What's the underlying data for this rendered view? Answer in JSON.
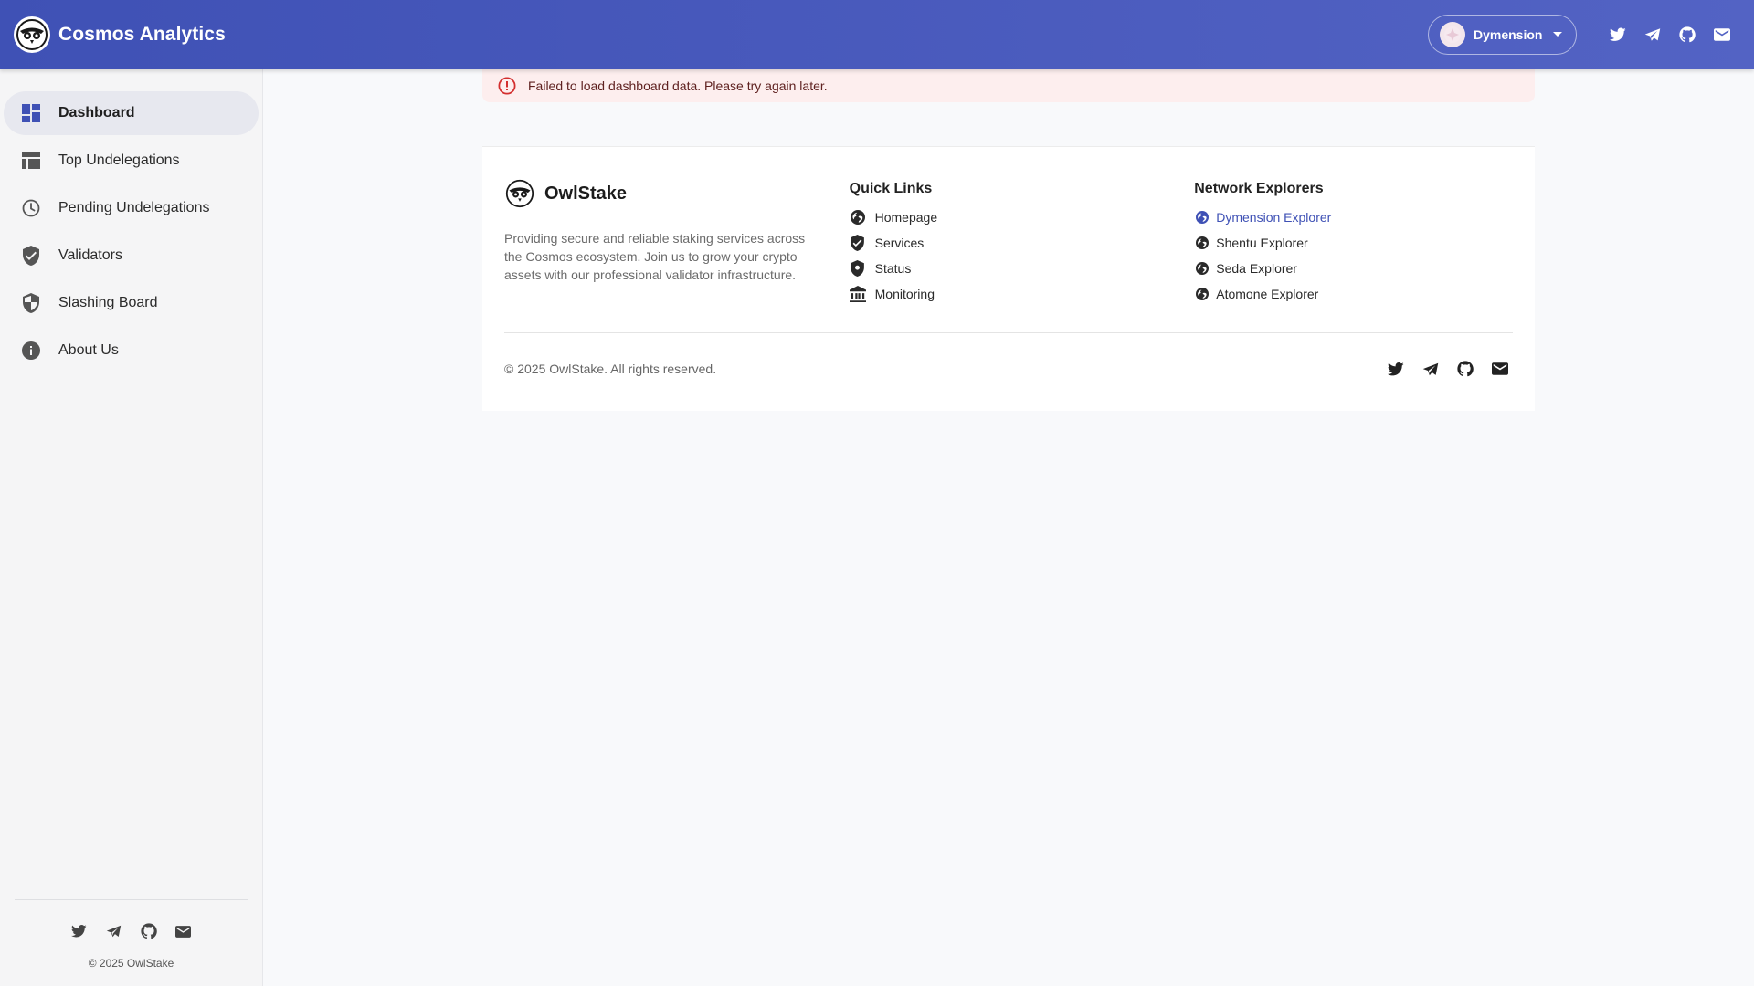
{
  "header": {
    "title": "Cosmos Analytics",
    "network": {
      "label": "Dymension"
    },
    "social": [
      "twitter-icon",
      "telegram-icon",
      "github-icon",
      "email-icon"
    ]
  },
  "sidebar": {
    "items": [
      {
        "label": "Dashboard",
        "icon": "dashboard-icon",
        "active": true
      },
      {
        "label": "Top Undelegations",
        "icon": "table-icon",
        "active": false
      },
      {
        "label": "Pending Undelegations",
        "icon": "clock-icon",
        "active": false
      },
      {
        "label": "Validators",
        "icon": "shield-check-icon",
        "active": false
      },
      {
        "label": "Slashing Board",
        "icon": "shield-half-icon",
        "active": false
      },
      {
        "label": "About Us",
        "icon": "info-icon",
        "active": false
      }
    ],
    "copyright": "© 2025 OwlStake"
  },
  "alert": {
    "message": "Failed to load dashboard data. Please try again later.",
    "severity": "error"
  },
  "footer": {
    "brand": "OwlStake",
    "description": "Providing secure and reliable staking services across the Cosmos ecosystem. Join us to grow your crypto assets with our professional validator infrastructure.",
    "quick_links": {
      "heading": "Quick Links",
      "items": [
        {
          "label": "Homepage",
          "icon": "globe-icon"
        },
        {
          "label": "Services",
          "icon": "shield-check-icon"
        },
        {
          "label": "Status",
          "icon": "shield-icon"
        },
        {
          "label": "Monitoring",
          "icon": "bank-icon"
        }
      ]
    },
    "explorers": {
      "heading": "Network Explorers",
      "items": [
        {
          "label": "Dymension Explorer",
          "icon": "globe-icon",
          "highlight": true
        },
        {
          "label": "Shentu Explorer",
          "icon": "globe-icon"
        },
        {
          "label": "Seda Explorer",
          "icon": "globe-icon"
        },
        {
          "label": "Atomone Explorer",
          "icon": "globe-icon"
        }
      ]
    },
    "copyright": "© 2025 OwlStake. All rights reserved."
  },
  "colors": {
    "primary": "#3f51b5",
    "header_gradient_end": "#5363c4",
    "error": "#d32f2f",
    "alert_bg": "#fdeeee"
  }
}
